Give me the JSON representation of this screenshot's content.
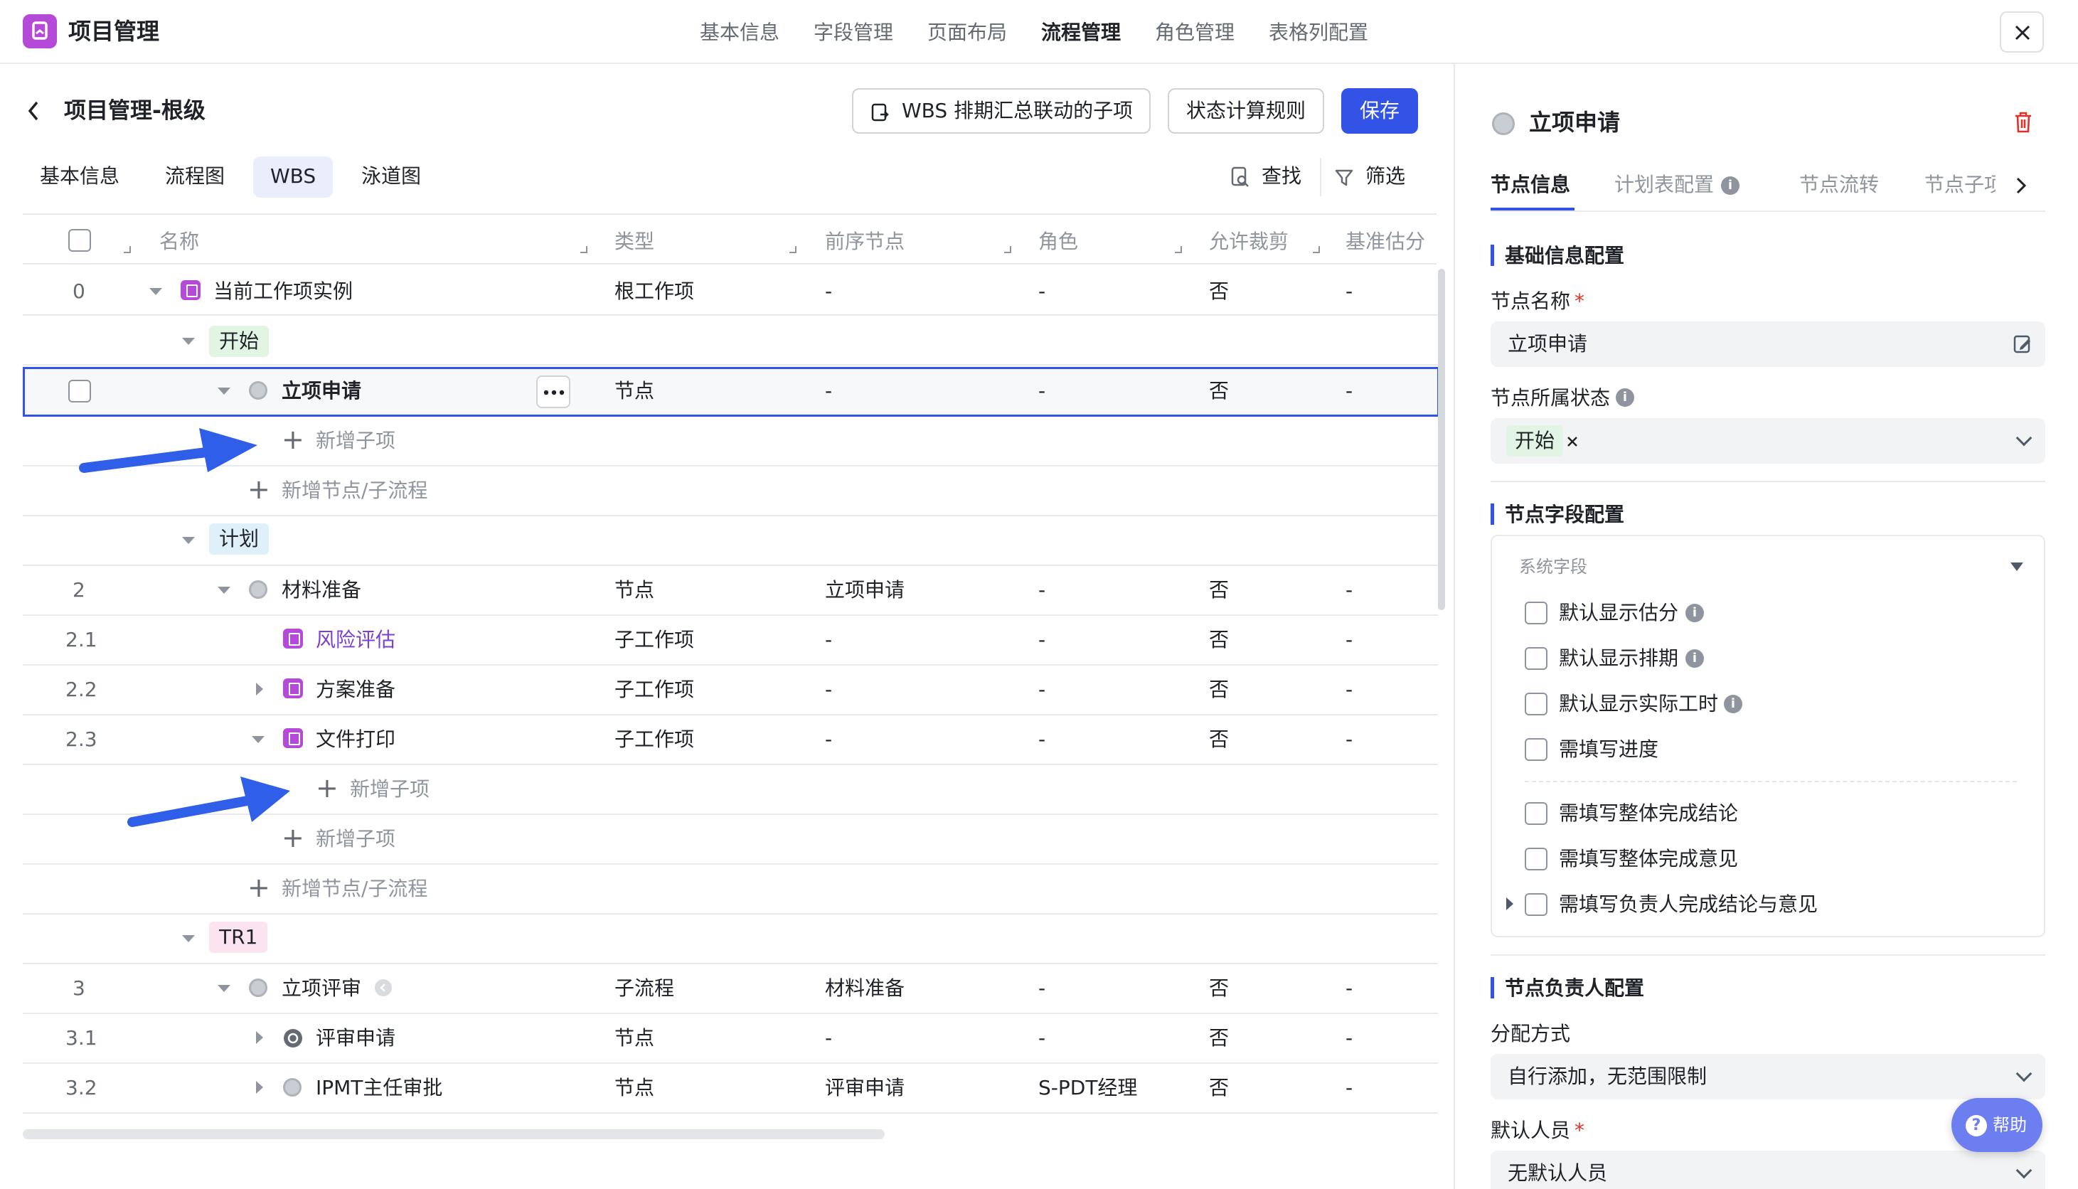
{
  "app": {
    "title": "项目管理"
  },
  "top_nav": [
    "基本信息",
    "字段管理",
    "页面布局",
    "流程管理",
    "角色管理",
    "表格列配置"
  ],
  "header": {
    "title": "项目管理-根级",
    "wbs_button": "WBS 排期汇总联动的子项",
    "rule_button": "状态计算规则",
    "save_button": "保存"
  },
  "sub_tabs": [
    "基本信息",
    "流程图",
    "WBS",
    "泳道图"
  ],
  "toolbar": {
    "search": "查找",
    "filter": "筛选"
  },
  "columns": [
    "名称",
    "类型",
    "前序节点",
    "角色",
    "允许裁剪",
    "基准估分"
  ],
  "rows": {
    "r0": {
      "num": "0",
      "name": "当前工作项实例",
      "type": "根工作项",
      "pre": "-",
      "role": "-",
      "cut": "否",
      "est": "-"
    },
    "stage1": "开始",
    "r1": {
      "name": "立项申请",
      "type": "节点",
      "pre": "-",
      "role": "-",
      "cut": "否",
      "est": "-"
    },
    "add_child": "新增子项",
    "add_node": "新增节点/子流程",
    "stage2": "计划",
    "r2": {
      "num": "2",
      "name": "材料准备",
      "type": "节点",
      "pre": "立项申请",
      "role": "-",
      "cut": "否",
      "est": "-"
    },
    "r21": {
      "num": "2.1",
      "name": "风险评估",
      "type": "子工作项",
      "pre": "-",
      "role": "-",
      "cut": "否",
      "est": "-"
    },
    "r22": {
      "num": "2.2",
      "name": "方案准备",
      "type": "子工作项",
      "pre": "-",
      "role": "-",
      "cut": "否",
      "est": "-"
    },
    "r23": {
      "num": "2.3",
      "name": "文件打印",
      "type": "子工作项",
      "pre": "-",
      "role": "-",
      "cut": "否",
      "est": "-"
    },
    "stage3": "TR1",
    "r3": {
      "num": "3",
      "name": "立项评审",
      "type": "子流程",
      "pre": "材料准备",
      "role": "-",
      "cut": "否",
      "est": "-"
    },
    "r31": {
      "num": "3.1",
      "name": "评审申请",
      "type": "节点",
      "pre": "-",
      "role": "-",
      "cut": "否",
      "est": "-"
    },
    "r32": {
      "num": "3.2",
      "name": "IPMT主任审批",
      "type": "节点",
      "pre": "评审申请",
      "role": "S-PDT经理",
      "cut": "否",
      "est": "-"
    }
  },
  "panel": {
    "title": "立项申请",
    "tabs": [
      "节点信息",
      "计划表配置",
      "节点流转",
      "节点子项"
    ],
    "basic_section": "基础信息配置",
    "node_name_label": "节点名称",
    "node_name_value": "立项申请",
    "node_state_label": "节点所属状态",
    "node_state_tag": "开始",
    "field_section": "节点字段配置",
    "system_fields_label": "系统字段",
    "options": [
      "默认显示估分",
      "默认显示排期",
      "默认显示实际工时",
      "需填写进度",
      "需填写整体完成结论",
      "需填写整体完成意见",
      "需填写负责人完成结论与意见"
    ],
    "owner_section": "节点负责人配置",
    "assign_label": "分配方式",
    "assign_value": "自行添加，无范围限制",
    "default_label": "默认人员",
    "default_value": "无默认人员",
    "help": "帮助"
  },
  "colors": {
    "accent": "#3352e6",
    "workitem": "#b549d8",
    "arrow": "#2f5fe8"
  }
}
